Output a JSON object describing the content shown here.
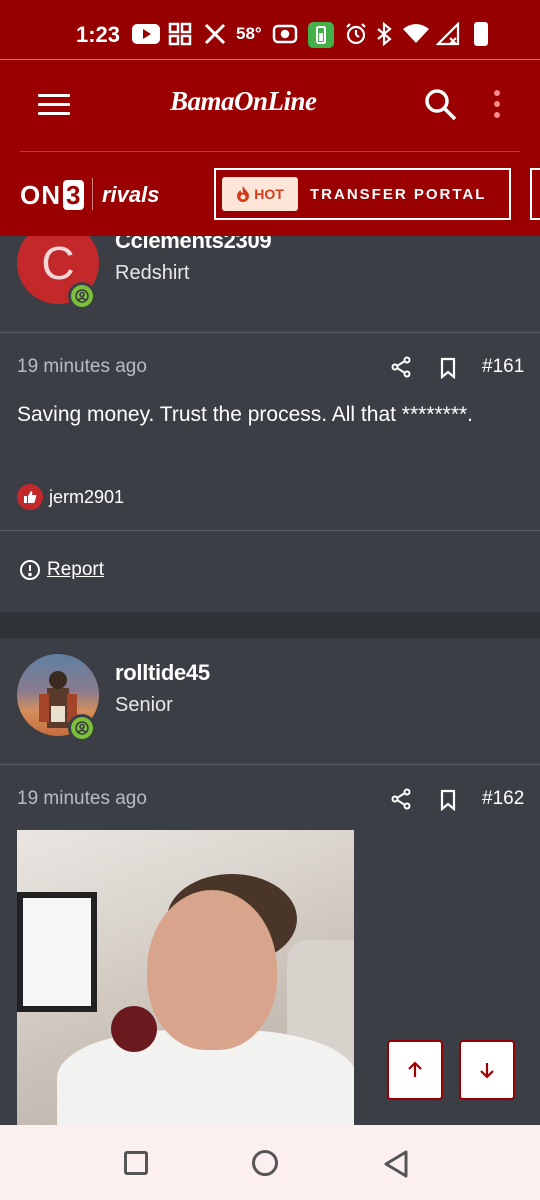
{
  "status_bar": {
    "time": "1:23",
    "temperature": "58°"
  },
  "header": {
    "logo": "BamaOnLine",
    "on3": "ON",
    "on3_num": "3",
    "rivals": "rivals",
    "hot_badge": "HOT",
    "transfer_portal": "TRANSFER PORTAL"
  },
  "posts": [
    {
      "username": "Cclements2309",
      "avatar_letter": "C",
      "rank": "Redshirt",
      "time": "19 minutes ago",
      "number": "#161",
      "text": "Saving money. Trust the process. All that ********.",
      "liked_by": "jerm2901",
      "report_label": "Report"
    },
    {
      "username": "rolltide45",
      "rank": "Senior",
      "time": "19 minutes ago",
      "number": "#162"
    }
  ],
  "colors": {
    "brand_red": "#9b0000",
    "content_bg": "#3b3f45",
    "online_green": "#7cbf3a"
  },
  "icons": [
    "menu-icon",
    "search-icon",
    "kebab-icon",
    "share-icon",
    "bookmark-icon",
    "thumbs-up-icon",
    "alert-circle-icon",
    "arrow-up-icon",
    "arrow-down-icon"
  ]
}
